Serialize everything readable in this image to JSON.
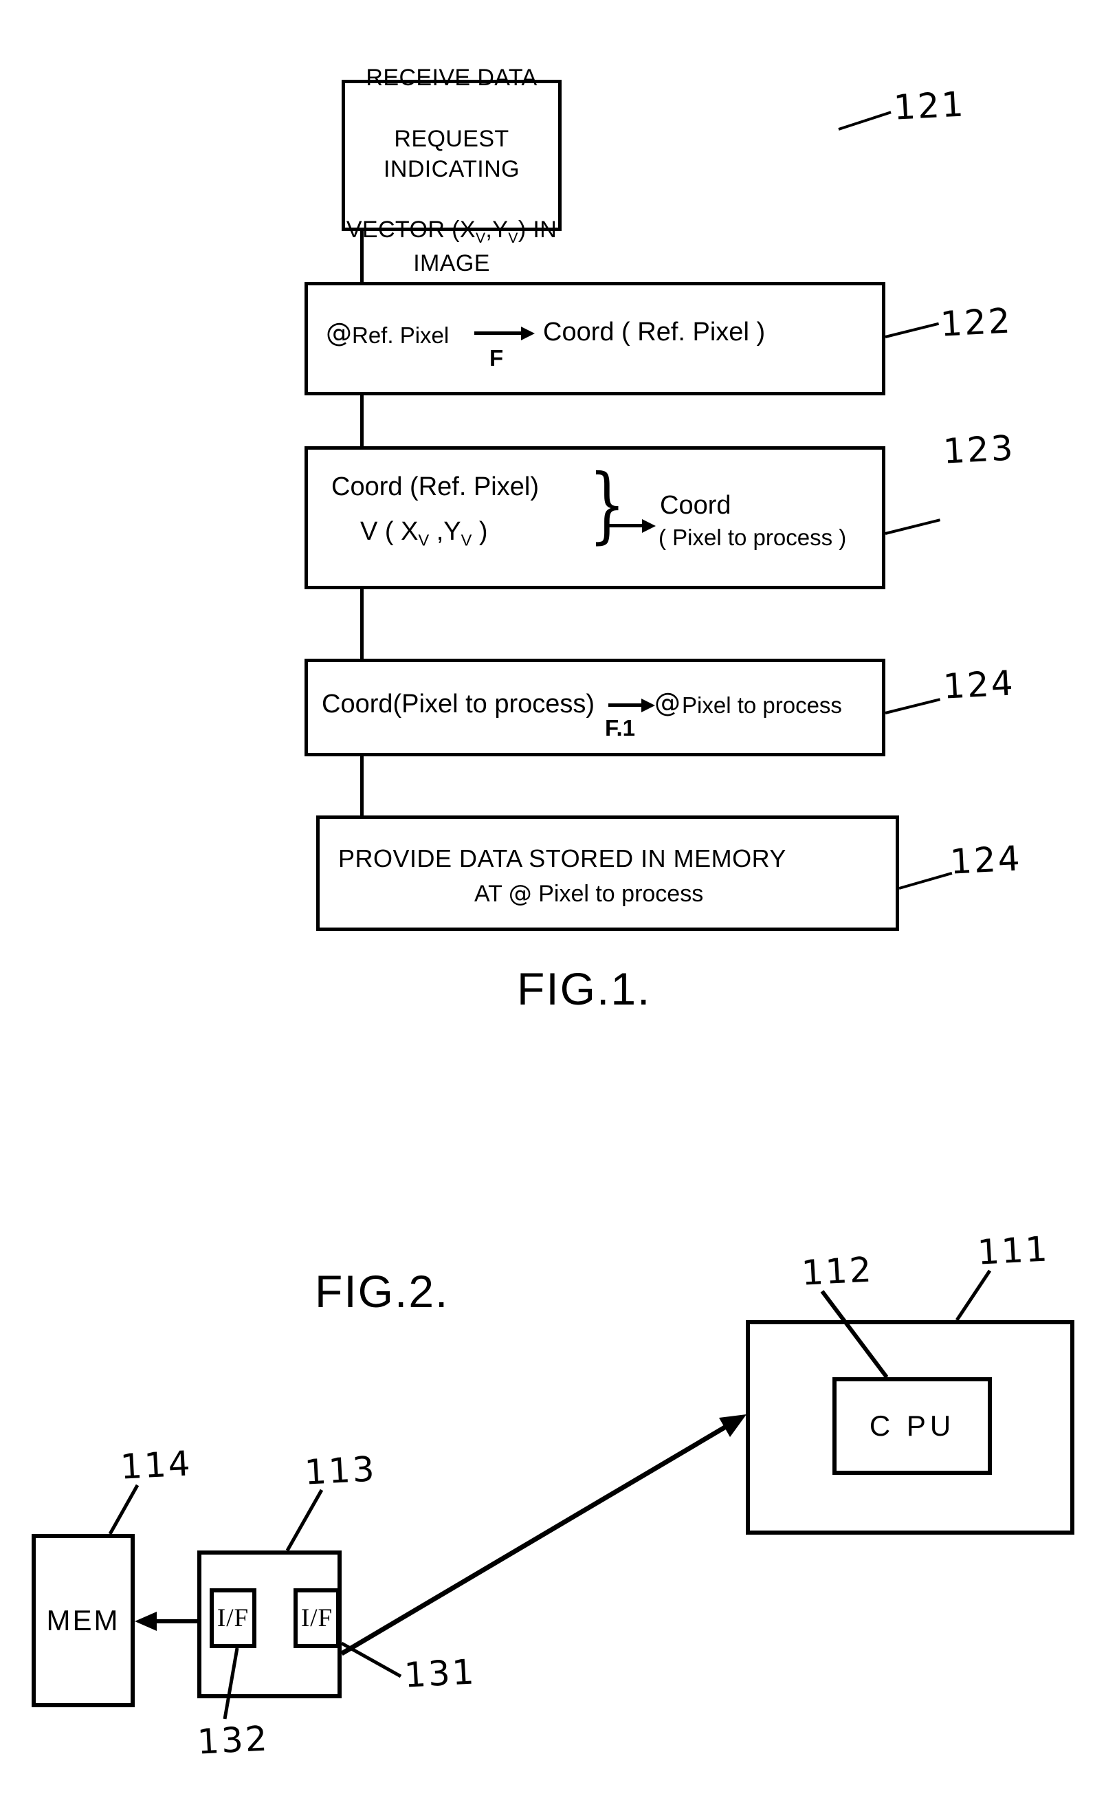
{
  "figures": [
    {
      "id": "fig1",
      "caption": "FIG.1.",
      "steps": [
        {
          "ref": "121",
          "text": "RECEIVE DATA\nREQUEST INDICATING\nVECTOR (Xv,Yv) IN IMAGE",
          "style": "plain"
        },
        {
          "ref": "122",
          "style": "formula",
          "left": "@ Ref. Pixel",
          "operator": "F",
          "right": "Coord ( Ref. Pixel )"
        },
        {
          "ref": "123",
          "style": "brace",
          "brace_top": "Coord (Ref. Pixel)",
          "brace_bottom": "V ( Xv ,Yv )",
          "result_top": "Coord",
          "result_bottom": "( Pixel to process )"
        },
        {
          "ref": "124",
          "style": "formula",
          "left": "Coord(Pixel to process)",
          "operator": "F.1",
          "right": "@ Pixel to process"
        },
        {
          "ref": "124",
          "style": "plain",
          "text": "PROVIDE DATA STORED IN MEMORY\nAT @ Pixel to process"
        }
      ]
    },
    {
      "id": "fig2",
      "caption": "FIG.2.",
      "blocks": [
        {
          "ref": "111",
          "label": "",
          "name": "host-container"
        },
        {
          "ref": "112",
          "label": "C PU",
          "name": "cpu"
        },
        {
          "ref": "113",
          "label": "",
          "name": "interface-unit"
        },
        {
          "ref": "114",
          "label": "MEM",
          "name": "memory"
        },
        {
          "ref": "131",
          "label": "I/F",
          "name": "interface-right"
        },
        {
          "ref": "132",
          "label": "I/F",
          "name": "interface-left"
        }
      ]
    }
  ],
  "labels": {
    "fig1_caption": "FIG.1.",
    "fig2_caption": "FIG.2.",
    "step1_line1": "RECEIVE DATA",
    "step1_line2": "REQUEST INDICATING",
    "step1_line3_a": "VECTOR (X",
    "step1_line3_sub1": "V",
    "step1_line3_b": ",Y",
    "step1_line3_sub2": "V",
    "step1_line3_c": ") IN IMAGE",
    "step2_at": "@",
    "step2_left": "Ref. Pixel",
    "step2_op": "F",
    "step2_right": "Coord ( Ref. Pixel )",
    "step3_brace_top": "Coord (Ref. Pixel)",
    "step3_brace_bottom_a": "V ( X",
    "step3_brace_bottom_sub1": "V",
    "step3_brace_bottom_b": " ,Y",
    "step3_brace_bottom_sub2": "V",
    "step3_brace_bottom_c": " )",
    "step3_brace_glyph": "}",
    "step3_result_top": "Coord",
    "step3_result_bottom": "( Pixel to process )",
    "step4_left": "Coord(Pixel to process)",
    "step4_op": "F.1",
    "step4_at": "@",
    "step4_right": "Pixel to process",
    "step5_line1": "PROVIDE DATA STORED IN MEMORY",
    "step5_line2_a": "AT",
    "step5_at": "@",
    "step5_line2_b": "Pixel to process",
    "ref_121": "121",
    "ref_122": "122",
    "ref_123": "123",
    "ref_124": "124",
    "ref_124b": "124",
    "ref_111": "111",
    "ref_112": "112",
    "ref_113": "113",
    "ref_114": "114",
    "ref_131": "131",
    "ref_132": "132",
    "cpu_label": "C PU",
    "mem_label": "MEM",
    "if_label_left": "I/F",
    "if_label_right": "I/F"
  },
  "colors": {
    "ink": "#000000",
    "paper": "#ffffff"
  }
}
